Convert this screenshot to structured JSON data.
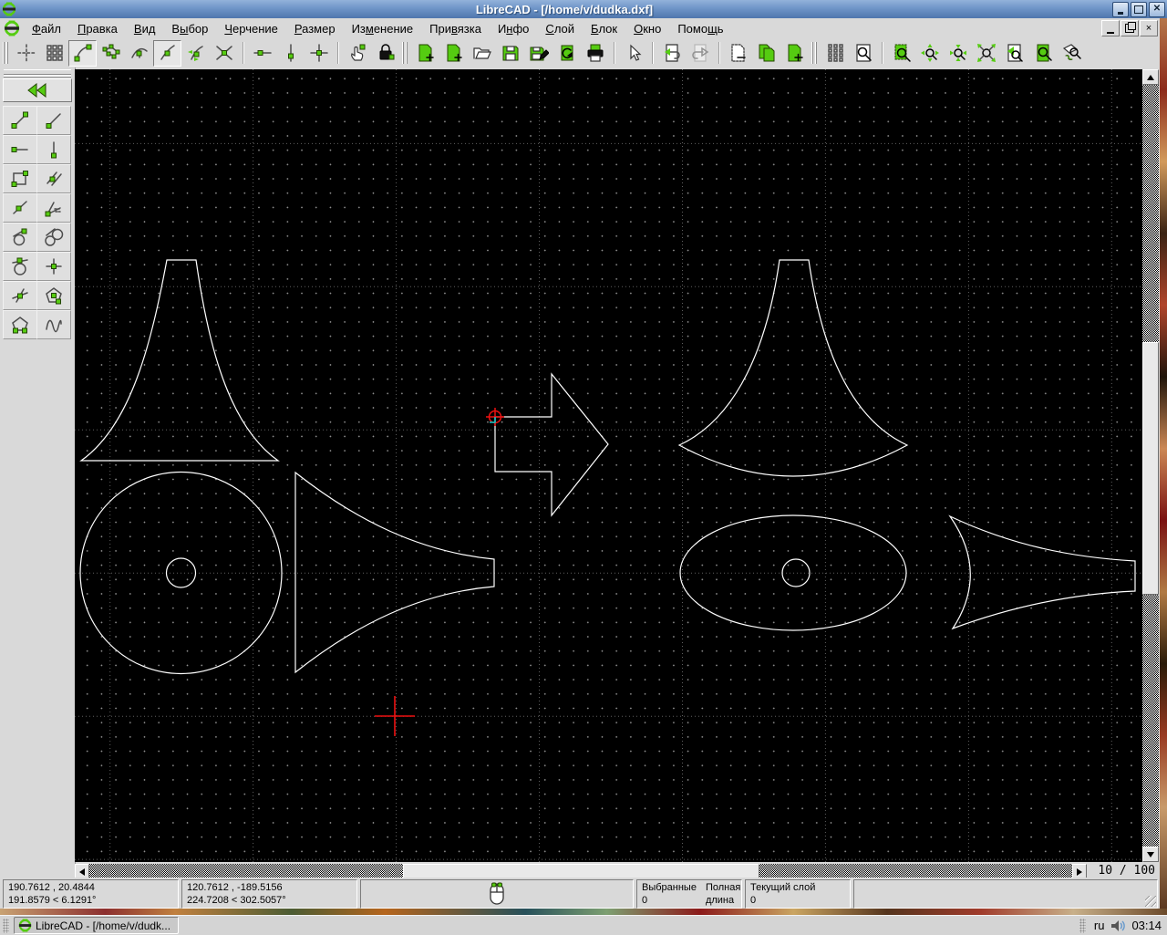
{
  "titlebar": {
    "title": "LibreCAD - [/home/v/dudka.dxf]"
  },
  "menubar": {
    "items": [
      {
        "label": "Файл",
        "accel": 0
      },
      {
        "label": "Правка",
        "accel": 0
      },
      {
        "label": "Вид",
        "accel": 0
      },
      {
        "label": "Выбор",
        "accel": 1
      },
      {
        "label": "Черчение",
        "accel": 0
      },
      {
        "label": "Размер",
        "accel": 0
      },
      {
        "label": "Изменение",
        "accel": 2
      },
      {
        "label": "Привязка",
        "accel": 3
      },
      {
        "label": "Инфо",
        "accel": 1
      },
      {
        "label": "Слой",
        "accel": 0
      },
      {
        "label": "Блок",
        "accel": 0
      },
      {
        "label": "Окно",
        "accel": 0
      },
      {
        "label": "Помощь",
        "accel": 4
      }
    ]
  },
  "toolbar": {
    "snap_icons": [
      "snap-free",
      "snap-grid",
      "snap-endpoint",
      "snap-on-entity",
      "snap-center",
      "snap-middle",
      "snap-distance",
      "snap-intersection"
    ],
    "active_snaps": [
      "snap-endpoint",
      "snap-middle"
    ],
    "restrict_icons": [
      "restrict-horizontal",
      "restrict-vertical",
      "restrict-orthogonal"
    ],
    "relzero_icons": [
      "set-relative-zero",
      "lock-relative-zero"
    ],
    "file_icons": [
      "new-drawing",
      "new-window",
      "open",
      "save",
      "save-as",
      "print-preview",
      "print"
    ],
    "edit_icons": [
      "pointer",
      "undo",
      "redo",
      "cut",
      "copy",
      "paste"
    ],
    "view_icons": [
      "grid-toggle",
      "zoom",
      "zoom-window",
      "zoom-in",
      "zoom-out",
      "auto-zoom",
      "zoom-previous",
      "zoom-page",
      "redraw"
    ]
  },
  "left_toolbar": {
    "icons": [
      "line-two-points",
      "line-angle",
      "line-horizontal",
      "line-vertical",
      "rectangle",
      "line-parallel-through-point",
      "line-parallel",
      "line-bisector",
      "line-tangent-point-circle",
      "line-tangent-two-circles",
      "line-tangent-orthogonal",
      "line-orthogonal",
      "line-relative-angle",
      "polygon-center-corner",
      "polygon-two-corners",
      "line-freehand"
    ]
  },
  "canvas": {
    "background": "#000000",
    "shape_color": "#ffffff",
    "origin_color": "#ee1100",
    "zoom_indicator": "10 / 100",
    "shapes": [
      "bell-front-left",
      "disc-with-hole",
      "horn-side-left",
      "block-arrow-right",
      "bell-front-right",
      "ellipse-with-hole",
      "horn-side-right",
      "origin-cross",
      "relative-zero-marker"
    ]
  },
  "statusbar": {
    "abs_line1": "190.7612 , 20.4844",
    "abs_line2": "191.8579 < 6.1291°",
    "rel_line1": "120.7612 , -189.5156",
    "rel_line2": "224.7208 < 302.5057°",
    "selected_label": "Выбранные",
    "selected_value": "0",
    "length_label": "Полная длина",
    "length_value": "0",
    "layer_label": "Текущий слой",
    "layer_value": "0"
  },
  "taskbar": {
    "task_button": "LibreCAD - [/home/v/dudk...",
    "keyboard_layout": "ru",
    "clock": "03:14"
  }
}
